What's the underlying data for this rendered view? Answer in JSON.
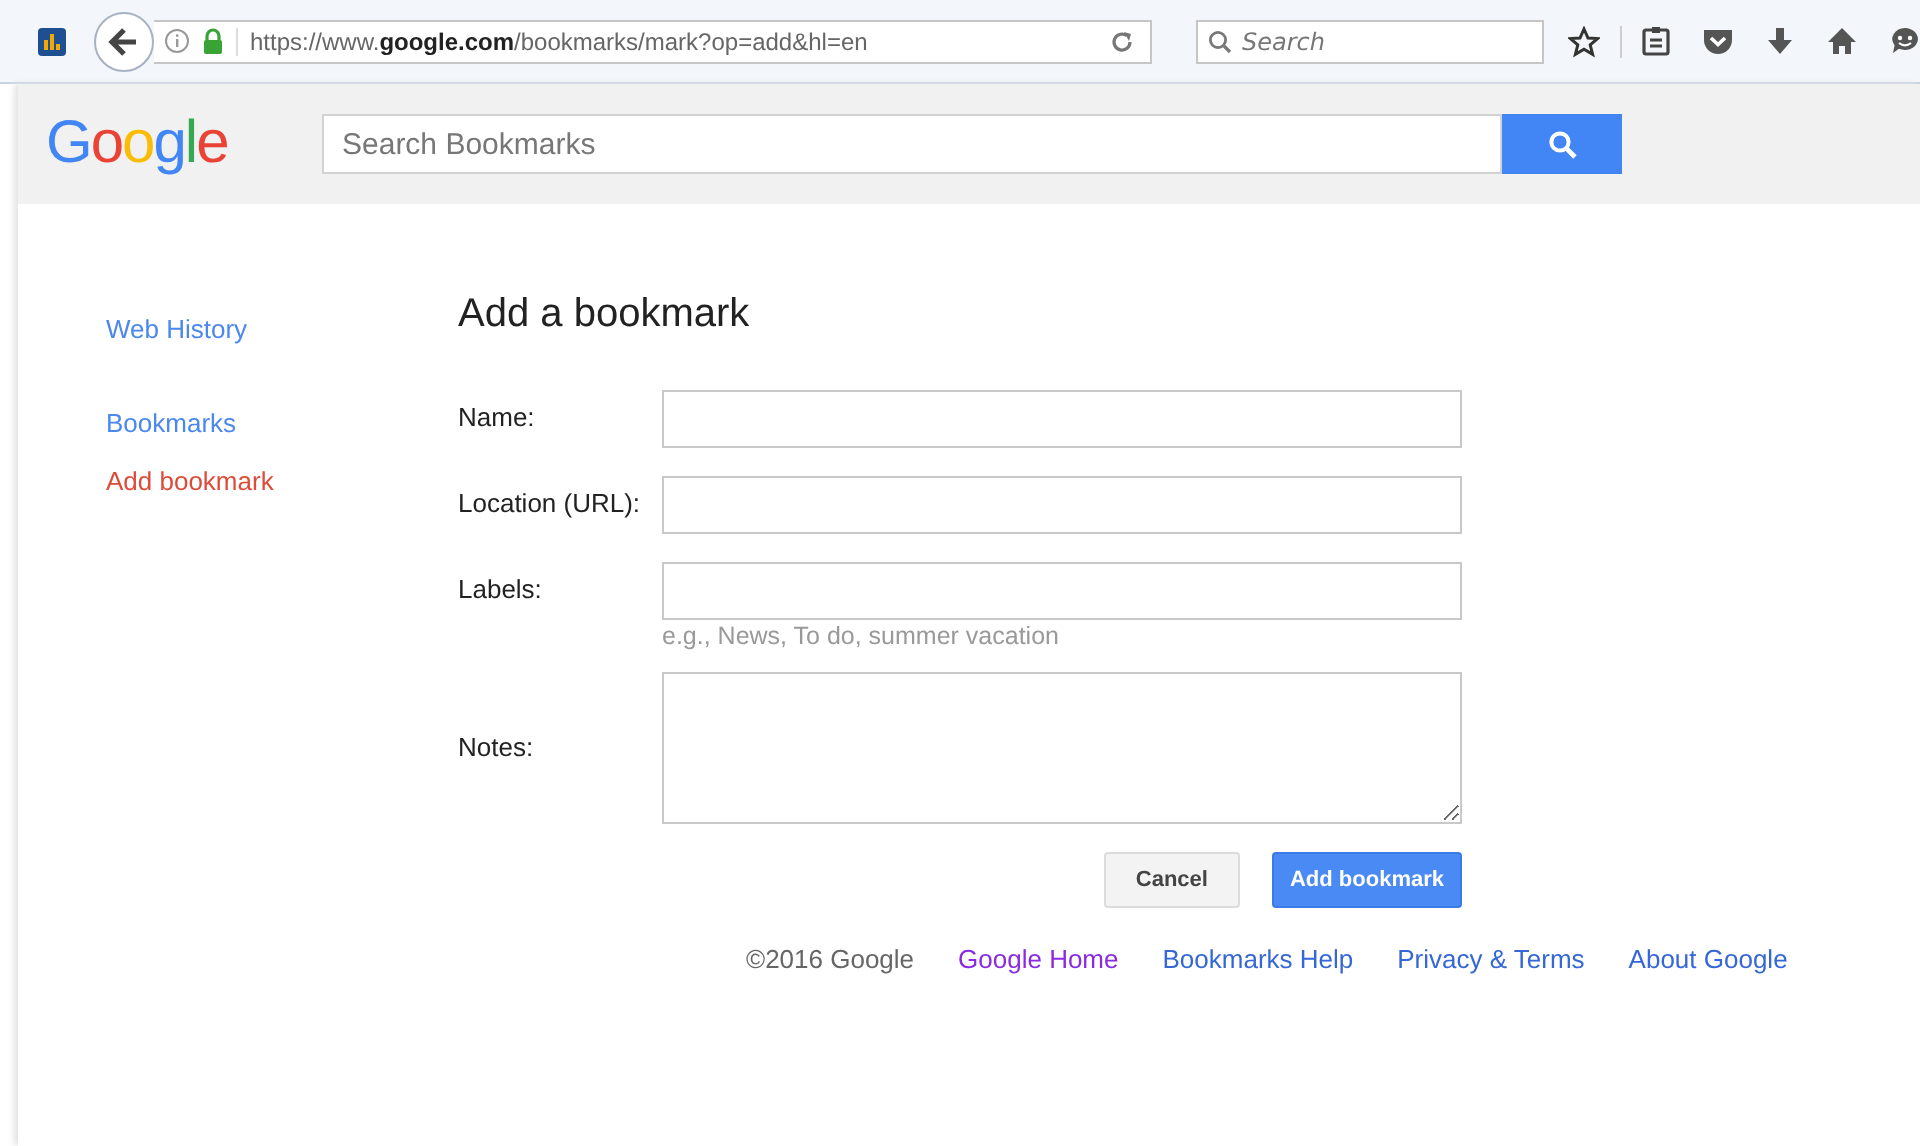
{
  "browser": {
    "url": "https://www.**google.com**/bookmarks/mark?op=add&hl=en",
    "search": {
      "placeholder": "Search"
    }
  },
  "header": {
    "logo": "Google",
    "search": {
      "placeholder": "Search Bookmarks"
    }
  },
  "sidebar": {
    "items": [
      {
        "label": "Web History",
        "selected": false
      },
      {
        "label": "Bookmarks",
        "selected": false
      },
      {
        "label": "Add bookmark",
        "selected": true
      }
    ]
  },
  "form": {
    "title": "Add a bookmark",
    "fields": [
      {
        "kind": "line",
        "label": "Name:"
      },
      {
        "kind": "line",
        "label": "Location (URL):"
      },
      {
        "kind": "line",
        "label": "Labels:",
        "hint": "e.g., News, To do, summer vacation"
      },
      {
        "kind": "area",
        "label": "Notes:"
      }
    ],
    "buttons": [
      {
        "label": "Cancel",
        "primary": false
      },
      {
        "label": "Add bookmark",
        "primary": true
      }
    ]
  },
  "footer": {
    "copyright": "©2016 Google",
    "links": [
      {
        "label": "Google Home",
        "visited": true
      },
      {
        "label": "Bookmarks Help",
        "visited": false
      },
      {
        "label": "Privacy & Terms",
        "visited": false
      },
      {
        "label": "About Google",
        "visited": false
      }
    ]
  }
}
